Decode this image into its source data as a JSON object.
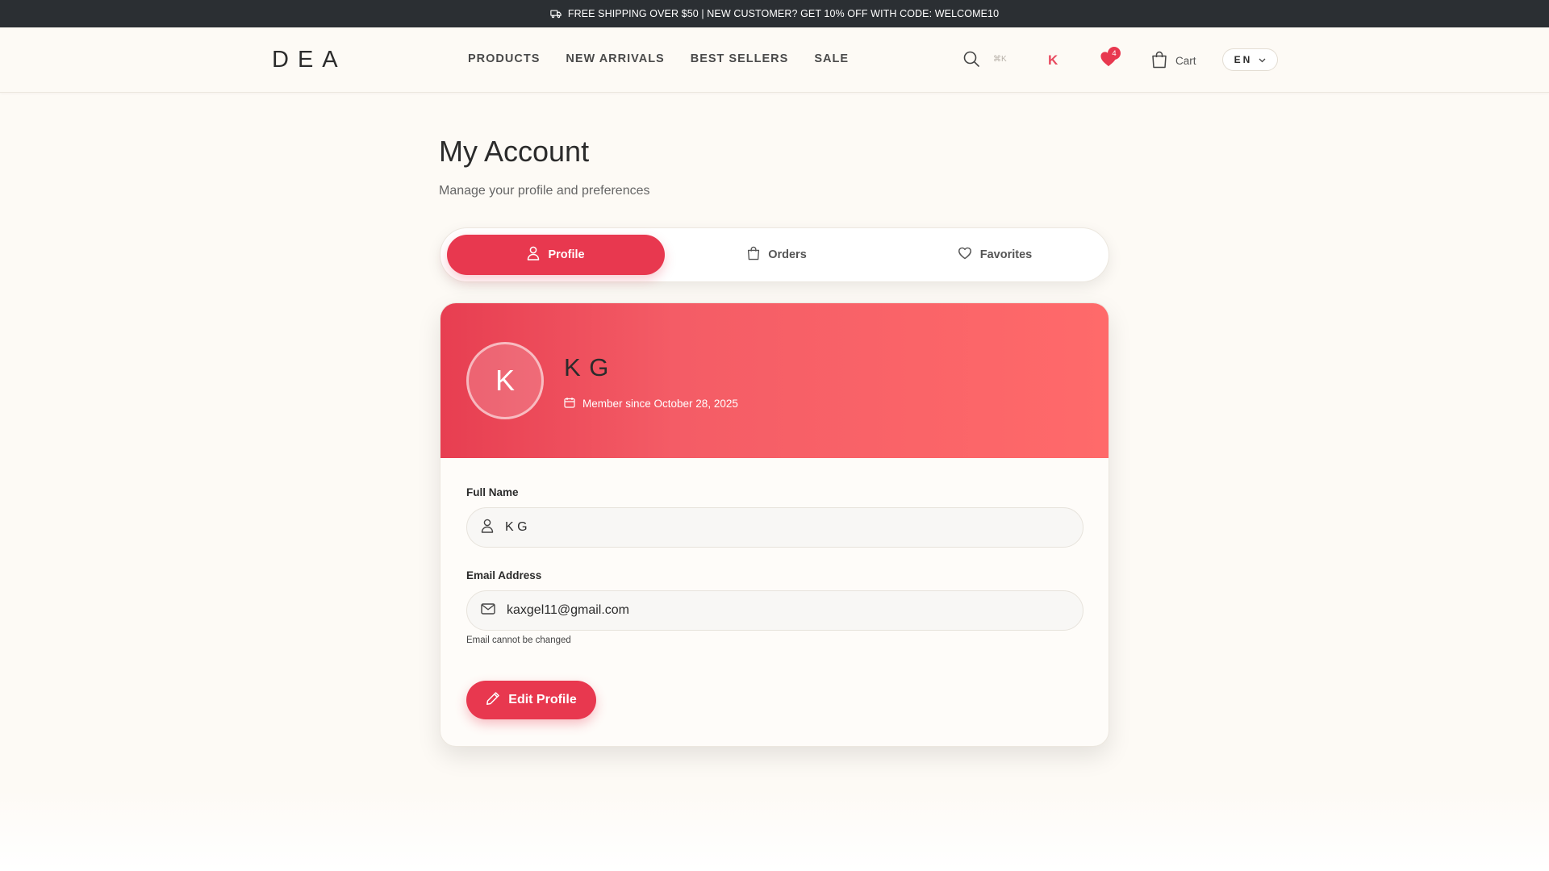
{
  "promo": {
    "text": "FREE SHIPPING OVER $50 | NEW CUSTOMER? GET 10% OFF WITH CODE: WELCOME10",
    "icon": "truck-icon"
  },
  "header": {
    "logo": "DEA",
    "nav": [
      "PRODUCTS",
      "NEW ARRIVALS",
      "BEST SELLERS",
      "SALE"
    ],
    "search_shortcut": "⌘K",
    "user_initial": "K",
    "wishlist_count": "4",
    "cart_label": "Cart",
    "language": "EN",
    "accent_color": "#e8384f"
  },
  "page": {
    "title": "My Account",
    "subtitle": "Manage your profile and preferences"
  },
  "tabs": [
    {
      "label": "Profile",
      "icon": "user-icon",
      "active": true
    },
    {
      "label": "Orders",
      "icon": "shopping-bag-icon",
      "active": false
    },
    {
      "label": "Favorites",
      "icon": "heart-icon",
      "active": false
    }
  ],
  "profile": {
    "avatar_initial": "K",
    "name": "K G",
    "member_since": "Member since October 28, 2025",
    "full_name_label": "Full Name",
    "full_name_value": "K G",
    "email_label": "Email Address",
    "email_value": "kaxgel11@gmail.com",
    "email_note": "Email cannot be changed",
    "edit_button": "Edit Profile"
  }
}
